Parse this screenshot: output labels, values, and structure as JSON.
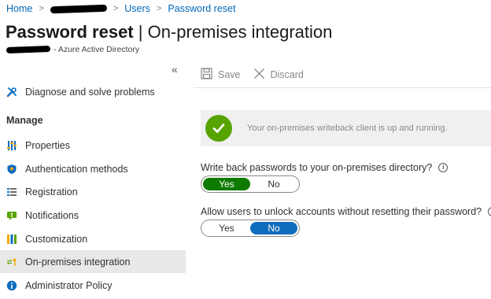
{
  "breadcrumb": {
    "home": "Home",
    "users": "Users",
    "current": "Password reset"
  },
  "page": {
    "title_bold": "Password reset",
    "title_rest": " | On-premises integration",
    "subtitle": "- Azure Active Directory"
  },
  "sidebar": {
    "collapse_glyph": "«",
    "top_item": {
      "label": "Diagnose and solve problems",
      "icon": "wrench-icon"
    },
    "section_label": "Manage",
    "items": [
      {
        "label": "Properties",
        "icon": "properties-icon"
      },
      {
        "label": "Authentication methods",
        "icon": "shield-icon"
      },
      {
        "label": "Registration",
        "icon": "list-icon"
      },
      {
        "label": "Notifications",
        "icon": "notification-icon"
      },
      {
        "label": "Customization",
        "icon": "customization-icon"
      },
      {
        "label": "On-premises integration",
        "icon": "key-sync-icon",
        "selected": true
      },
      {
        "label": "Administrator Policy",
        "icon": "info-icon"
      }
    ]
  },
  "toolbar": {
    "save_label": "Save",
    "discard_label": "Discard"
  },
  "banner": {
    "text": "Your on-premises writeback client is up and running.",
    "icon": "check-circle-icon",
    "color": "#57a300"
  },
  "settings": [
    {
      "label": "Write back passwords to your on-premises directory?",
      "yes_label": "Yes",
      "no_label": "No",
      "selected": "Yes",
      "selected_color": "#0f7a00"
    },
    {
      "label": "Allow users to unlock accounts without resetting their password?",
      "yes_label": "Yes",
      "no_label": "No",
      "selected": "No",
      "selected_color": "#0f6cbd"
    }
  ],
  "colors": {
    "link": "#0066b8",
    "selected_nav_bg": "#e8e8e8"
  }
}
